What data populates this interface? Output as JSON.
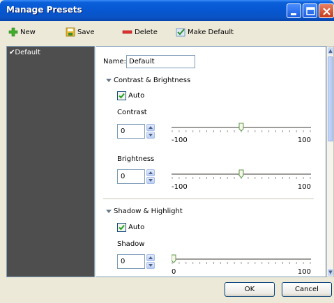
{
  "window": {
    "title": "Manage Presets"
  },
  "toolbar": {
    "new_label": "New",
    "save_label": "Save",
    "delete_label": "Delete",
    "make_default_label": "Make Default"
  },
  "sidebar": {
    "items": [
      {
        "label": "Default",
        "checked": true
      }
    ]
  },
  "form": {
    "name_label": "Name:",
    "name_value": "Default",
    "contrast_brightness": {
      "title": "Contrast & Brightness",
      "auto_label": "Auto",
      "auto_checked": true,
      "contrast": {
        "label": "Contrast",
        "value": "0",
        "min_label": "-100",
        "max_label": "100",
        "min": -100,
        "max": 100,
        "current": 0
      },
      "brightness": {
        "label": "Brightness",
        "value": "0",
        "min_label": "-100",
        "max_label": "100",
        "min": -100,
        "max": 100,
        "current": 0
      }
    },
    "shadow_highlight": {
      "title": "Shadow & Highlight",
      "auto_label": "Auto",
      "auto_checked": true,
      "shadow": {
        "label": "Shadow",
        "value": "0",
        "min_label": "0",
        "max_label": "100",
        "min": 0,
        "max": 100,
        "current": 0
      }
    }
  },
  "buttons": {
    "ok_label": "OK",
    "cancel_label": "Cancel"
  },
  "icons": {
    "new": "plus-icon",
    "save": "floppy-icon",
    "delete": "minus-icon",
    "make_default": "check-default-icon"
  },
  "colors": {
    "titlebar": "#0757D1",
    "sidebar_bg": "#4E4E4E",
    "window_bg": "#ECE9D8"
  }
}
